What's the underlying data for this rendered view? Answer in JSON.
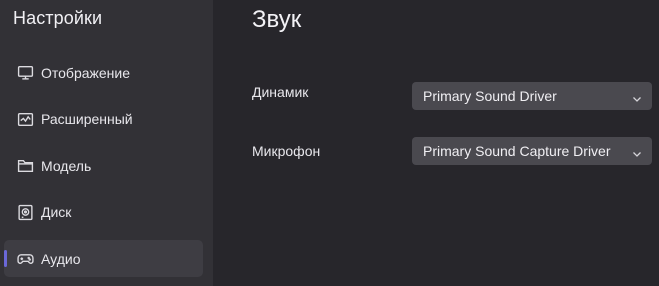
{
  "sidebar": {
    "title": "Настройки",
    "items": [
      {
        "label": "Отображение",
        "icon": "monitor-icon",
        "active": false
      },
      {
        "label": "Расширенный",
        "icon": "chart-icon",
        "active": false
      },
      {
        "label": "Модель",
        "icon": "folder-icon",
        "active": false
      },
      {
        "label": "Диск",
        "icon": "disk-icon",
        "active": false
      },
      {
        "label": "Аудио",
        "icon": "gamepad-icon",
        "active": true
      }
    ]
  },
  "main": {
    "title": "Звук",
    "speaker": {
      "label": "Динамик",
      "value": "Primary Sound Driver"
    },
    "microphone": {
      "label": "Микрофон",
      "value": "Primary Sound Capture Driver"
    }
  },
  "colors": {
    "background": "#27262b",
    "sidebar": "#323136",
    "active_item": "#3e3d43",
    "accent": "#6b68d8",
    "select": "#4a494f"
  }
}
